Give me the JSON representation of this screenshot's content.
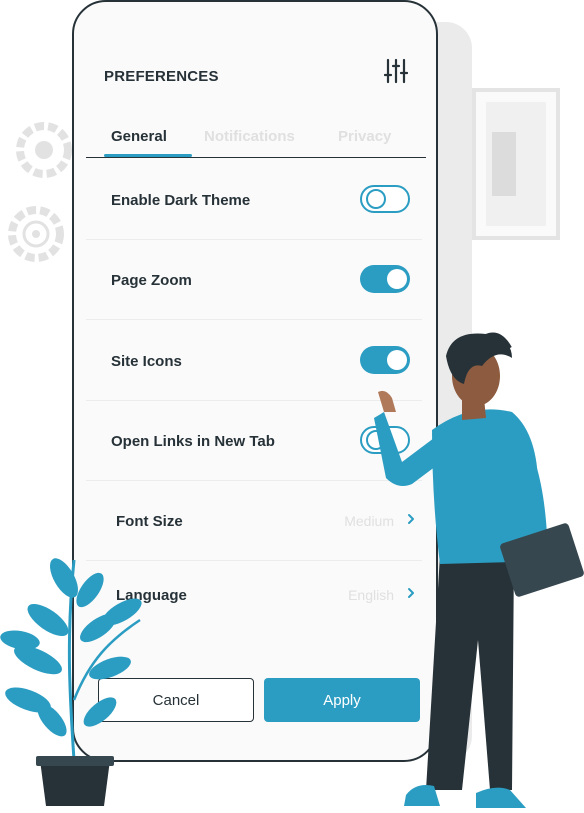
{
  "header": {
    "title": "PREFERENCES",
    "filter_icon": "sliders-icon"
  },
  "tabs": [
    {
      "label": "General",
      "active": true
    },
    {
      "label": "Notifications",
      "active": false
    },
    {
      "label": "Privacy",
      "active": false
    }
  ],
  "settings": {
    "toggles": [
      {
        "label": "Enable Dark Theme",
        "enabled": false
      },
      {
        "label": "Page Zoom",
        "enabled": true
      },
      {
        "label": "Site Icons",
        "enabled": true
      },
      {
        "label": "Open Links in New Tab",
        "enabled": false
      }
    ],
    "selects": [
      {
        "label": "Font Size",
        "value": "Medium"
      },
      {
        "label": "Language",
        "value": "English"
      }
    ]
  },
  "actions": {
    "cancel_label": "Cancel",
    "apply_label": "Apply"
  },
  "colors": {
    "accent": "#2b9dc2",
    "text": "#263238",
    "muted": "#e0e0e0",
    "background": "#fafafa"
  }
}
